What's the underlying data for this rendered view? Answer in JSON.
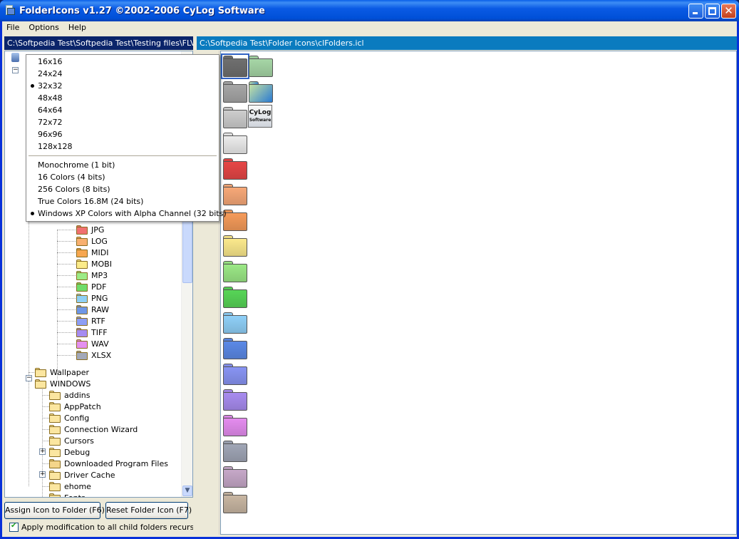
{
  "window": {
    "title": "FolderIcons v1.27 ©2002-2006 CyLog Software"
  },
  "menu": [
    "File",
    "Options",
    "Help"
  ],
  "left_path": "C:\\Softpedia Test\\Softpedia Test\\Testing files\\FLV",
  "right_path": "C:\\Softpedia Test\\Folder Icons\\clFolders.icl",
  "popup_menu": {
    "sizes": [
      {
        "label": "16x16",
        "selected": false
      },
      {
        "label": "24x24",
        "selected": false
      },
      {
        "label": "32x32",
        "selected": true
      },
      {
        "label": "48x48",
        "selected": false
      },
      {
        "label": "64x64",
        "selected": false
      },
      {
        "label": "72x72",
        "selected": false
      },
      {
        "label": "96x96",
        "selected": false
      },
      {
        "label": "128x128",
        "selected": false
      }
    ],
    "depths": [
      {
        "label": "Monochrome (1 bit)",
        "selected": false
      },
      {
        "label": "16 Colors (4 bits)",
        "selected": false
      },
      {
        "label": "256 Colors (8 bits)",
        "selected": false
      },
      {
        "label": "True Colors 16.8M (24 bits)",
        "selected": false
      },
      {
        "label": "Windows XP Colors with Alpha Channel (32 bits)",
        "selected": true
      }
    ]
  },
  "tree": {
    "filetype_folders": [
      {
        "label": "JPG",
        "color": "#f07070"
      },
      {
        "label": "LOG",
        "color": "#f8b070"
      },
      {
        "label": "MIDI",
        "color": "#f7a74f"
      },
      {
        "label": "MOBI",
        "color": "#fbeb8a"
      },
      {
        "label": "MP3",
        "color": "#9ceb86"
      },
      {
        "label": "PDF",
        "color": "#6fdc6a"
      },
      {
        "label": "PNG",
        "color": "#8fd0f5"
      },
      {
        "label": "RAW",
        "color": "#6e96e6"
      },
      {
        "label": "RTF",
        "color": "#8d9ef5"
      },
      {
        "label": "TIFF",
        "color": "#a68cf0"
      },
      {
        "label": "WAV",
        "color": "#e58ff0"
      },
      {
        "label": "XLSX",
        "color": "#a2a8b8"
      }
    ],
    "wallpaper": "Wallpaper",
    "windows": "WINDOWS",
    "windows_children": [
      {
        "label": "addins",
        "expandable": false,
        "icon": "folder"
      },
      {
        "label": "AppPatch",
        "expandable": false,
        "icon": "folder"
      },
      {
        "label": "Config",
        "expandable": false,
        "icon": "folder"
      },
      {
        "label": "Connection Wizard",
        "expandable": false,
        "icon": "folder"
      },
      {
        "label": "Cursors",
        "expandable": false,
        "icon": "folder"
      },
      {
        "label": "Debug",
        "expandable": true,
        "icon": "folder"
      },
      {
        "label": "Downloaded Program Files",
        "expandable": false,
        "icon": "special-folder"
      },
      {
        "label": "Driver Cache",
        "expandable": true,
        "icon": "folder"
      },
      {
        "label": "ehome",
        "expandable": false,
        "icon": "folder"
      },
      {
        "label": "Fonts",
        "expandable": false,
        "icon": "folder"
      }
    ]
  },
  "buttons": {
    "assign": "Assign Icon to Folder (F6)",
    "reset": "Reset Folder Icon (F7)"
  },
  "checkbox": {
    "label": "Apply modification to all child folders recursively",
    "checked": true
  },
  "icon_grid": {
    "column1": [
      "#6f6f6f",
      "#a6a6a6",
      "#cdcdcd",
      "#ececec",
      "#e64646",
      "#f7a878",
      "#f59b5a",
      "#fbe98c",
      "#9be886",
      "#57d557",
      "#8fd0f8",
      "#5b89e6",
      "#8894f3",
      "#a88cf0",
      "#e48cef",
      "#a0a6b6",
      "#c6a8c8",
      "#c8b6a2"
    ],
    "column2": [
      "#a6d6a6",
      "#c4e2a4-#2a7ad2"
    ],
    "cylog_text": [
      "CyLog",
      "Software"
    ]
  }
}
